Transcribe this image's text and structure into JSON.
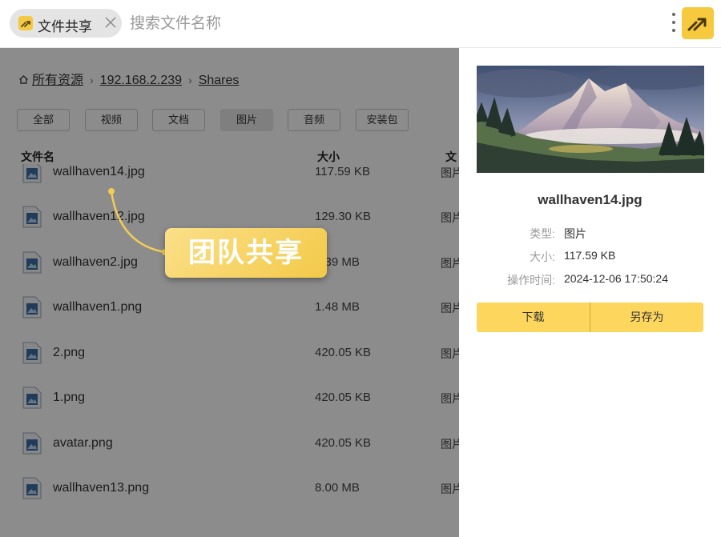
{
  "tab": {
    "label": "文件共享"
  },
  "search": {
    "placeholder": "搜索文件名称"
  },
  "breadcrumb": [
    "所有资源",
    "192.168.2.239",
    "Shares"
  ],
  "filters": [
    {
      "label": "全部",
      "active": false
    },
    {
      "label": "视频",
      "active": false
    },
    {
      "label": "文档",
      "active": false
    },
    {
      "label": "图片",
      "active": true
    },
    {
      "label": "音频",
      "active": false
    },
    {
      "label": "安装包",
      "active": false
    }
  ],
  "table": {
    "headers": {
      "name": "文件名",
      "size": "大小",
      "type": "文"
    },
    "rows": [
      {
        "name": "wallhaven14.jpg",
        "size": "117.59 KB",
        "type": "图片"
      },
      {
        "name": "wallhaven12.jpg",
        "size": "129.30 KB",
        "type": "图片"
      },
      {
        "name": "wallhaven2.jpg",
        "size": "1.39 MB",
        "type": "图片"
      },
      {
        "name": "wallhaven1.png",
        "size": "1.48 MB",
        "type": "图片"
      },
      {
        "name": "2.png",
        "size": "420.05 KB",
        "type": "图片"
      },
      {
        "name": "1.png",
        "size": "420.05 KB",
        "type": "图片"
      },
      {
        "name": "avatar.png",
        "size": "420.05 KB",
        "type": "图片"
      },
      {
        "name": "wallhaven13.png",
        "size": "8.00 MB",
        "type": "图片"
      }
    ]
  },
  "callout": {
    "text": "团队共享"
  },
  "detail": {
    "name": "wallhaven14.jpg",
    "meta": [
      {
        "label": "类型:",
        "value": "图片"
      },
      {
        "label": "大小:",
        "value": "117.59 KB"
      },
      {
        "label": "操作时间:",
        "value": "2024-12-06 17:50:24"
      }
    ],
    "download_label": "下载",
    "saveas_label": "另存为"
  },
  "colors": {
    "accent": "#fdd65e",
    "brand": "#f6c93f",
    "file_icon": "#3b6ea5"
  }
}
